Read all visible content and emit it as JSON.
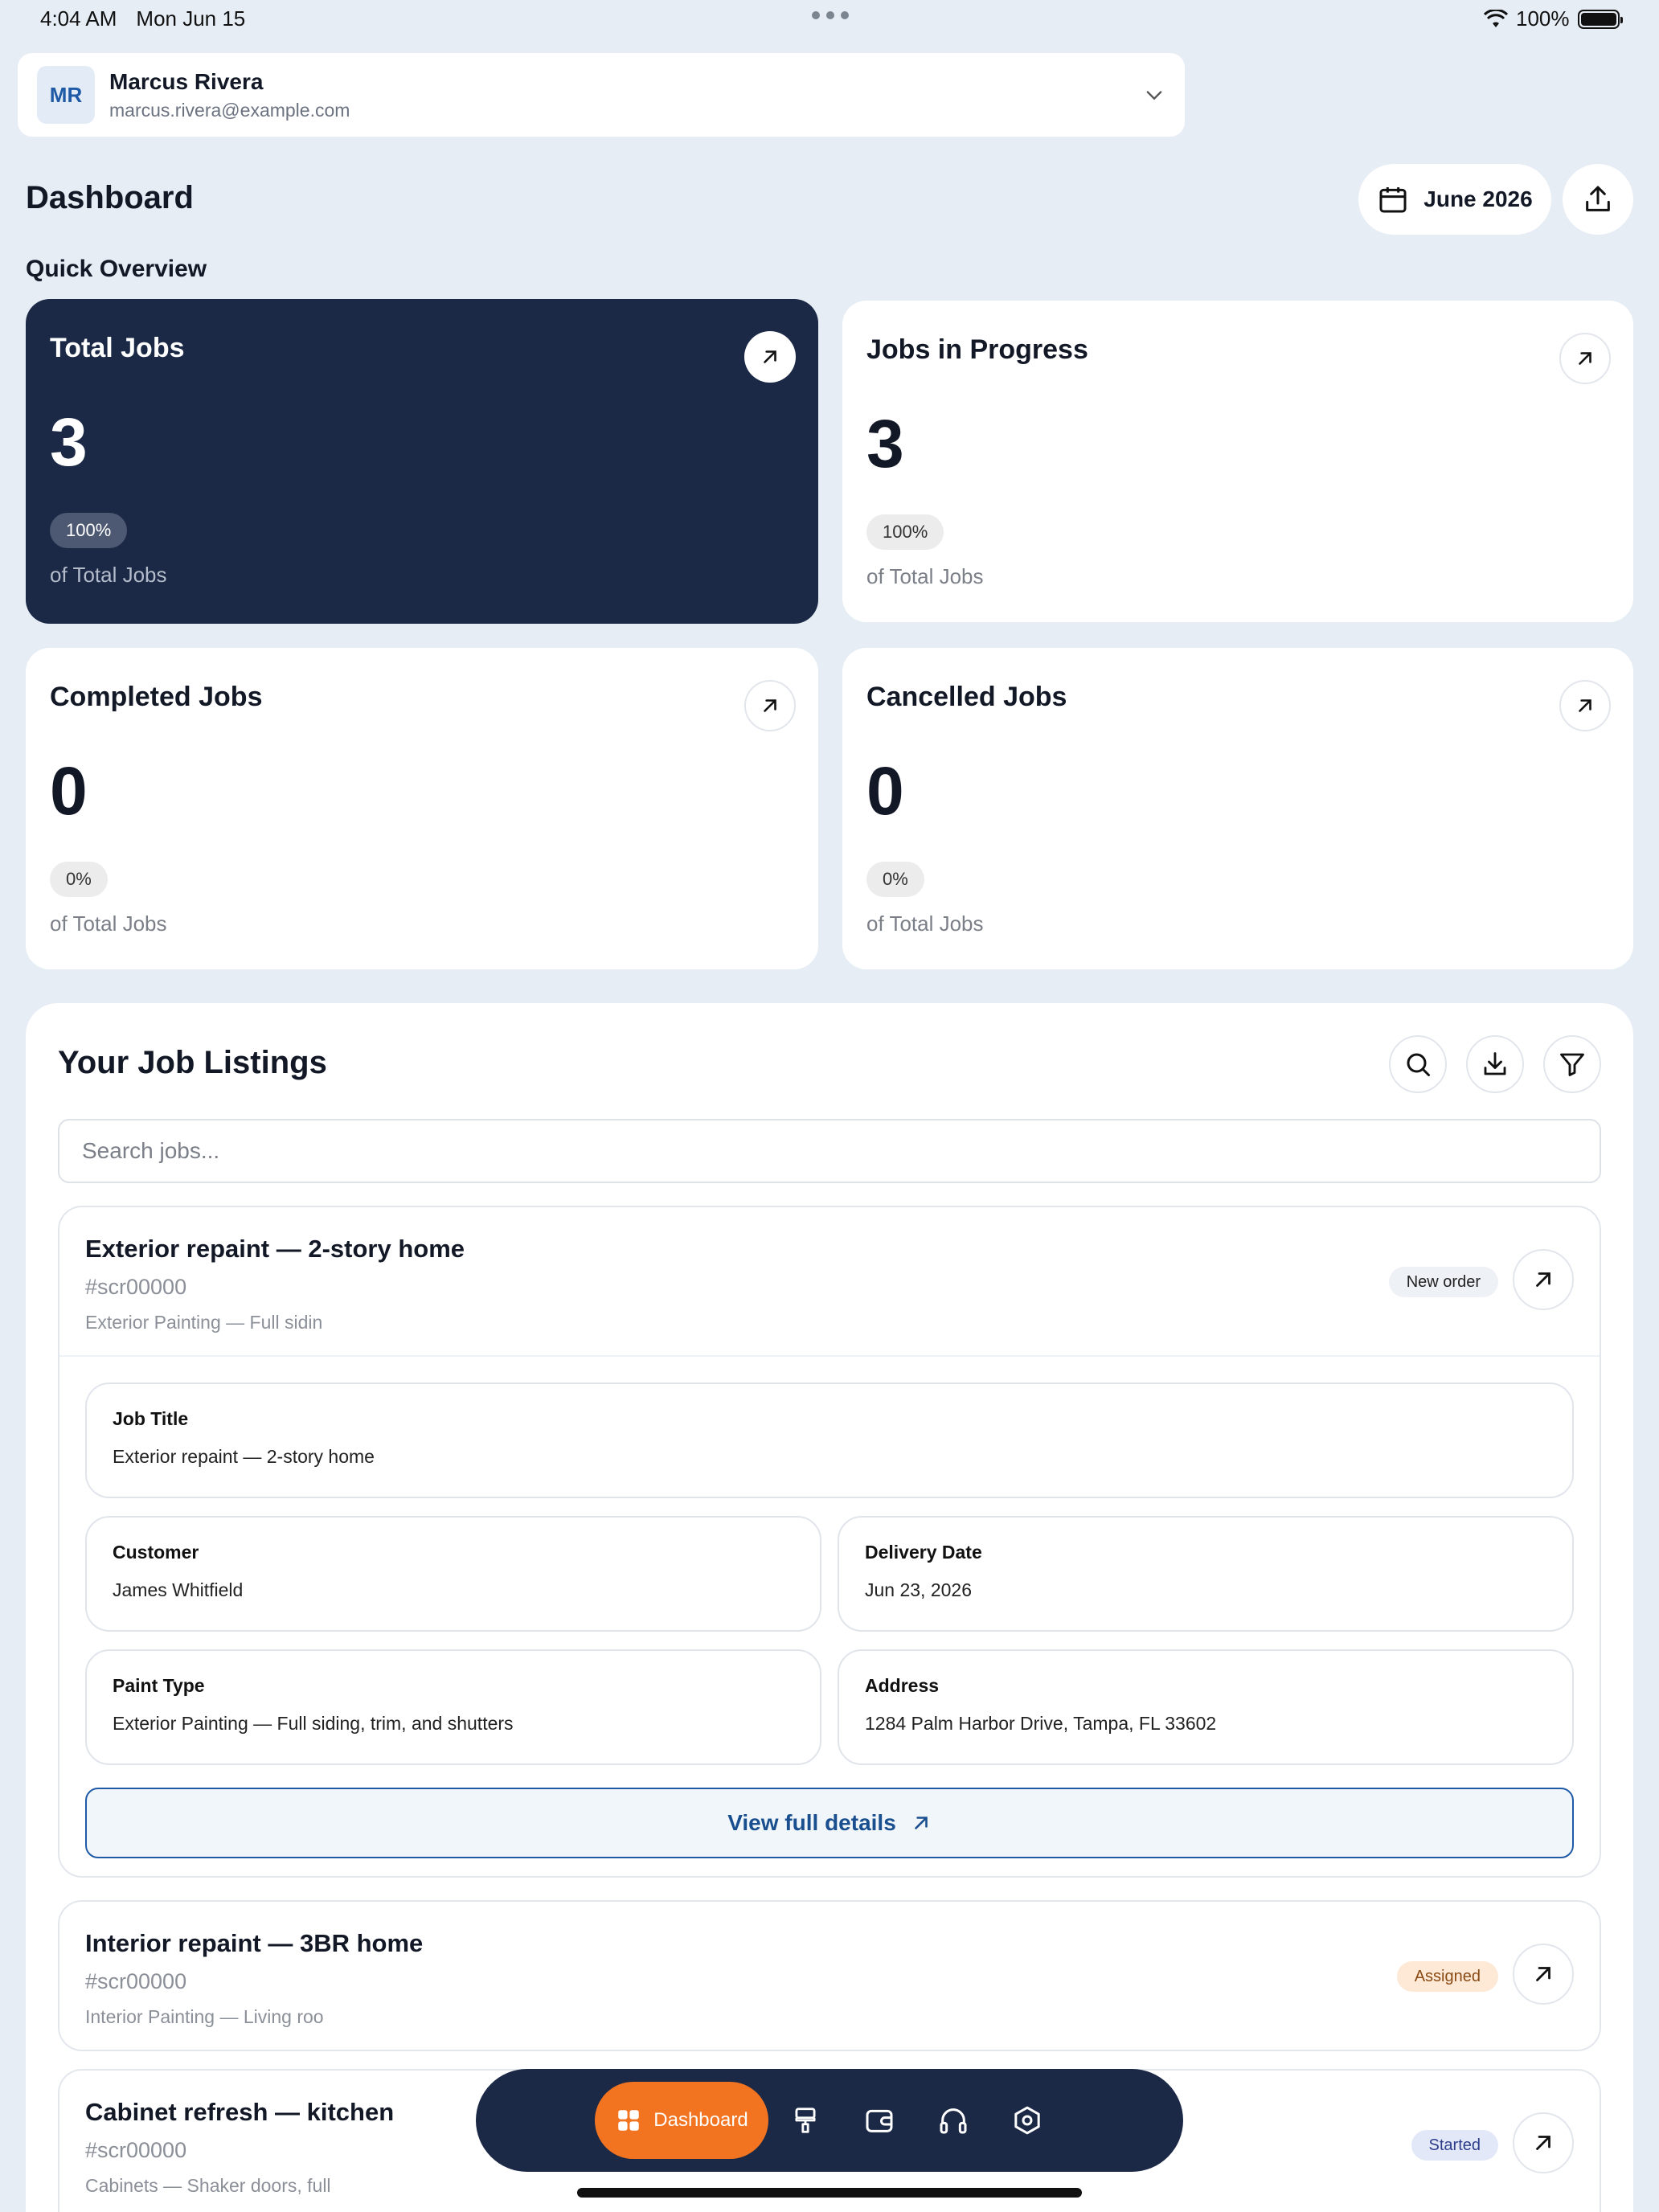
{
  "status_bar": {
    "time": "4:04 AM",
    "date": "Mon Jun 15",
    "battery": "100%"
  },
  "account": {
    "initials": "MR",
    "name": "Marcus Rivera",
    "email": "marcus.rivera@example.com"
  },
  "header": {
    "title": "Dashboard",
    "month": "June 2026"
  },
  "overview": {
    "title": "Quick Overview",
    "cards": [
      {
        "title": "Total Jobs",
        "value": "3",
        "percent": "100%",
        "sub": "of Total Jobs"
      },
      {
        "title": "Jobs in Progress",
        "value": "3",
        "percent": "100%",
        "sub": "of Total Jobs"
      },
      {
        "title": "Completed Jobs",
        "value": "0",
        "percent": "0%",
        "sub": "of Total Jobs"
      },
      {
        "title": "Cancelled Jobs",
        "value": "0",
        "percent": "0%",
        "sub": "of Total Jobs"
      }
    ]
  },
  "listings": {
    "title": "Your Job Listings",
    "search_placeholder": "Search jobs...",
    "jobs": [
      {
        "title": "Exterior repaint — 2-story home",
        "id": "#scr00000",
        "desc": "Exterior Painting — Full sidin",
        "badge": "New order",
        "badge_bg": "#eef1f5",
        "badge_color": "#222222",
        "fields": {
          "job_title_label": "Job Title",
          "job_title": "Exterior repaint — 2-story home",
          "customer_label": "Customer",
          "customer": "James Whitfield",
          "delivery_label": "Delivery Date",
          "delivery": "Jun 23, 2026",
          "paint_label": "Paint Type",
          "paint": "Exterior Painting — Full siding, trim, and shutters",
          "address_label": "Address",
          "address": "1284 Palm Harbor Drive, Tampa, FL 33602"
        },
        "view_label": "View full details"
      },
      {
        "title": "Interior repaint — 3BR home",
        "id": "#scr00000",
        "desc": "Interior Painting — Living roo",
        "badge": "Assigned",
        "badge_bg": "#fde9d6",
        "badge_color": "#8a4a14"
      },
      {
        "title": "Cabinet refresh — kitchen",
        "id": "#scr00000",
        "desc": "Cabinets — Shaker doors, full",
        "badge": "Started",
        "badge_bg": "#e3e8f8",
        "badge_color": "#2c3d8a"
      }
    ]
  },
  "nav": {
    "active_label": "Dashboard",
    "accent": "#f27420",
    "bar_color": "#1b2946"
  }
}
